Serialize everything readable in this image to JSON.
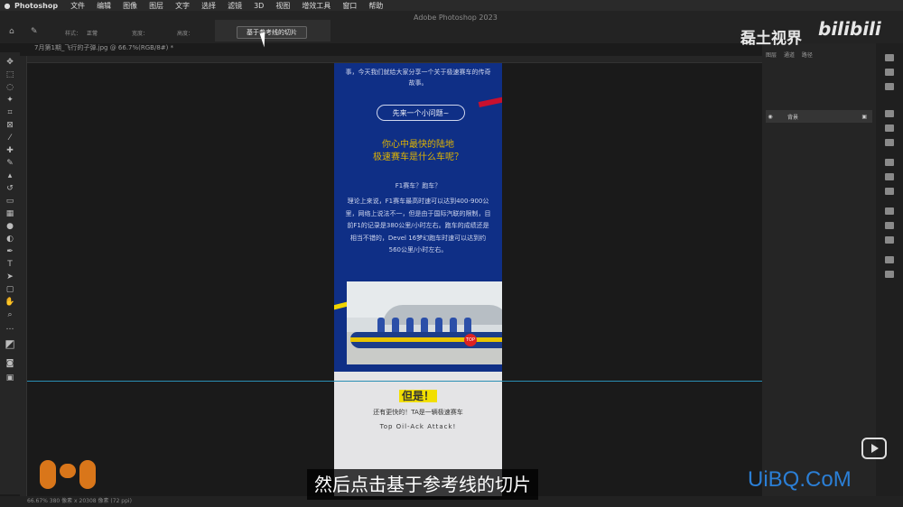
{
  "menubar": {
    "app": "Photoshop",
    "items": [
      "文件",
      "编辑",
      "图像",
      "图层",
      "文字",
      "选择",
      "滤镜",
      "3D",
      "视图",
      "增效工具",
      "窗口",
      "帮助"
    ]
  },
  "options": {
    "style_label": "样式：",
    "style_value": "正常",
    "width_label": "宽度：",
    "height_label": "高度：",
    "guide_slice_button": "基于参考线的切片"
  },
  "app_title": "Adobe Photoshop 2023",
  "doc_tab": "7月第1期_飞行的子弹.jpg @ 66.7%(RGB/8#) *",
  "document": {
    "intro": "事，今天我们就给大家分享一个关于极速赛车的传奇故事。",
    "question_pill": "先来一个小问题~",
    "headline_1": "你心中最快的陆地",
    "headline_2": "极速赛车是什么车呢？",
    "f1_question": "F1赛车？跑车？",
    "body": "理论上来说，F1赛车最高时速可以达到400-900公里，网络上说法不一，但是由于国际汽联的限制，目前F1的记录是380公里/小时左右。跑车的成绩还是相当不错的，Devel 16梦幻跑车时速可以达到约560公里/小时左右。",
    "car_badge": "TOP",
    "but": "但是！",
    "faster": "还有更快的！TA是一辆极速赛车",
    "top_oil": "Top Oil-Ack Attack!"
  },
  "layers_panel": {
    "tabs": [
      "图层",
      "通道",
      "路径"
    ],
    "layer_name": "背景"
  },
  "status_bar": "66.67%    380 像素 x 20308 像素 (72 ppi)",
  "watermark": {
    "channel": "磊土视界",
    "logo": "bilibili",
    "site": "UiBQ.CoM"
  },
  "subtitle": "然后点击基于参考线的切片",
  "colors": {
    "doc_blue": "#0f2f86",
    "headline_yellow": "#e0b400",
    "guide": "#2a8fb5",
    "orange_logo": "#d9761a"
  }
}
